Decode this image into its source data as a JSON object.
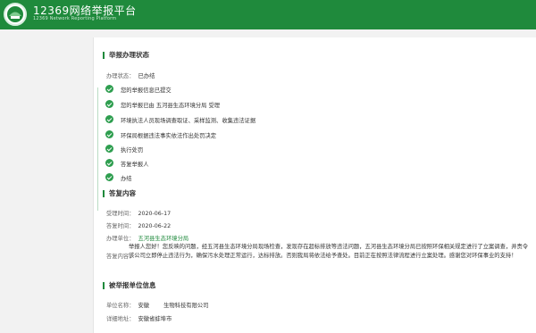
{
  "header": {
    "title": "12369网络举报平台",
    "subtitle": "12369 Network Reporting Platform"
  },
  "status_section": {
    "title": "举报办理状态",
    "state_label": "办理状态：",
    "state_value": "已办结",
    "steps": [
      "您的举报信息已提交",
      "您的举报已由 五河县生态环境分局 受理",
      "环境执法人员现场调查取证、采样监测、收集违法证据",
      "环保局根据违法事实依法作出处罚决定",
      "执行处罚",
      "答复举报人",
      "办结"
    ]
  },
  "reply_section": {
    "title": "答复内容",
    "accept_label": "受理时间：",
    "accept_value": "2020-06-17",
    "reply_time_label": "答复时间：",
    "reply_time_value": "2020-06-22",
    "unit_label": "办理单位：",
    "unit_value": "五河县生态环境分局",
    "content_label": "答复内容：",
    "content_text": "举报人您好！您反映的问题，经五河县生态环境分局现场检查，发现存在超标排放等违法问题，五河县生态环境分局已按照环保相关规定进行了立案调查，并责令该公司立即停止违法行为，确保污水处理正常运行，达标排放。否则我局将依法给予查处。目前正在按照法律流程进行立案处理。感谢您对环保事业的支持！"
  },
  "reported_section": {
    "title": "被举报单位信息",
    "name_label": "单位名称：",
    "name_value": "安徽        生物科技有限公司",
    "addr_label": "详细地址：",
    "addr_value": "安徽省蚌埠市"
  },
  "colors": {
    "brand": "#1f8a3c",
    "step_dot": "#2e9e4f"
  }
}
